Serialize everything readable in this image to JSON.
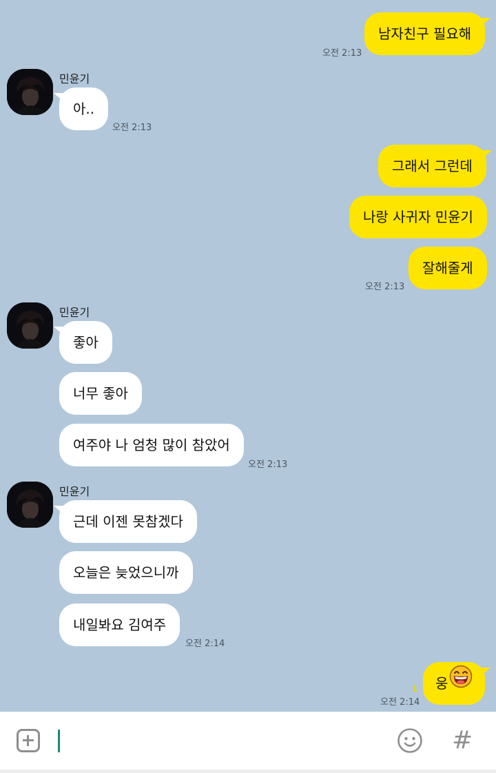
{
  "contact": {
    "name": "민윤기"
  },
  "messages": {
    "m1": "남자친구 필요해",
    "t1": "오전 2:13",
    "m2": "아..",
    "t2": "오전 2:13",
    "m3": "그래서 그런데",
    "m4": "나랑 사귀자 민윤기",
    "m5": "잘해줄게",
    "t5": "오전 2:13",
    "m6": "좋아",
    "m7": "너무 좋아",
    "m8": "여주야 나 엄청 많이 참았어",
    "t8": "오전 2:13",
    "m9": "근데 이젠 못참겠다",
    "m10": "오늘은 늦었으니까",
    "m11": "내일봐요 김여주",
    "t11": "오전 2:14",
    "m12": "웅",
    "m12_emoji": "laughing-face-emoji",
    "m12_unread": "1",
    "t12": "오전 2:14"
  },
  "input": {
    "value": "",
    "placeholder": ""
  },
  "icons": {
    "plus": "plus-icon",
    "emoticon": "smiley-icon",
    "hashtag": "#"
  },
  "colors": {
    "background": "#b2c7da",
    "my_bubble": "#fee500",
    "other_bubble": "#ffffff",
    "cursor": "#1b8a72"
  }
}
